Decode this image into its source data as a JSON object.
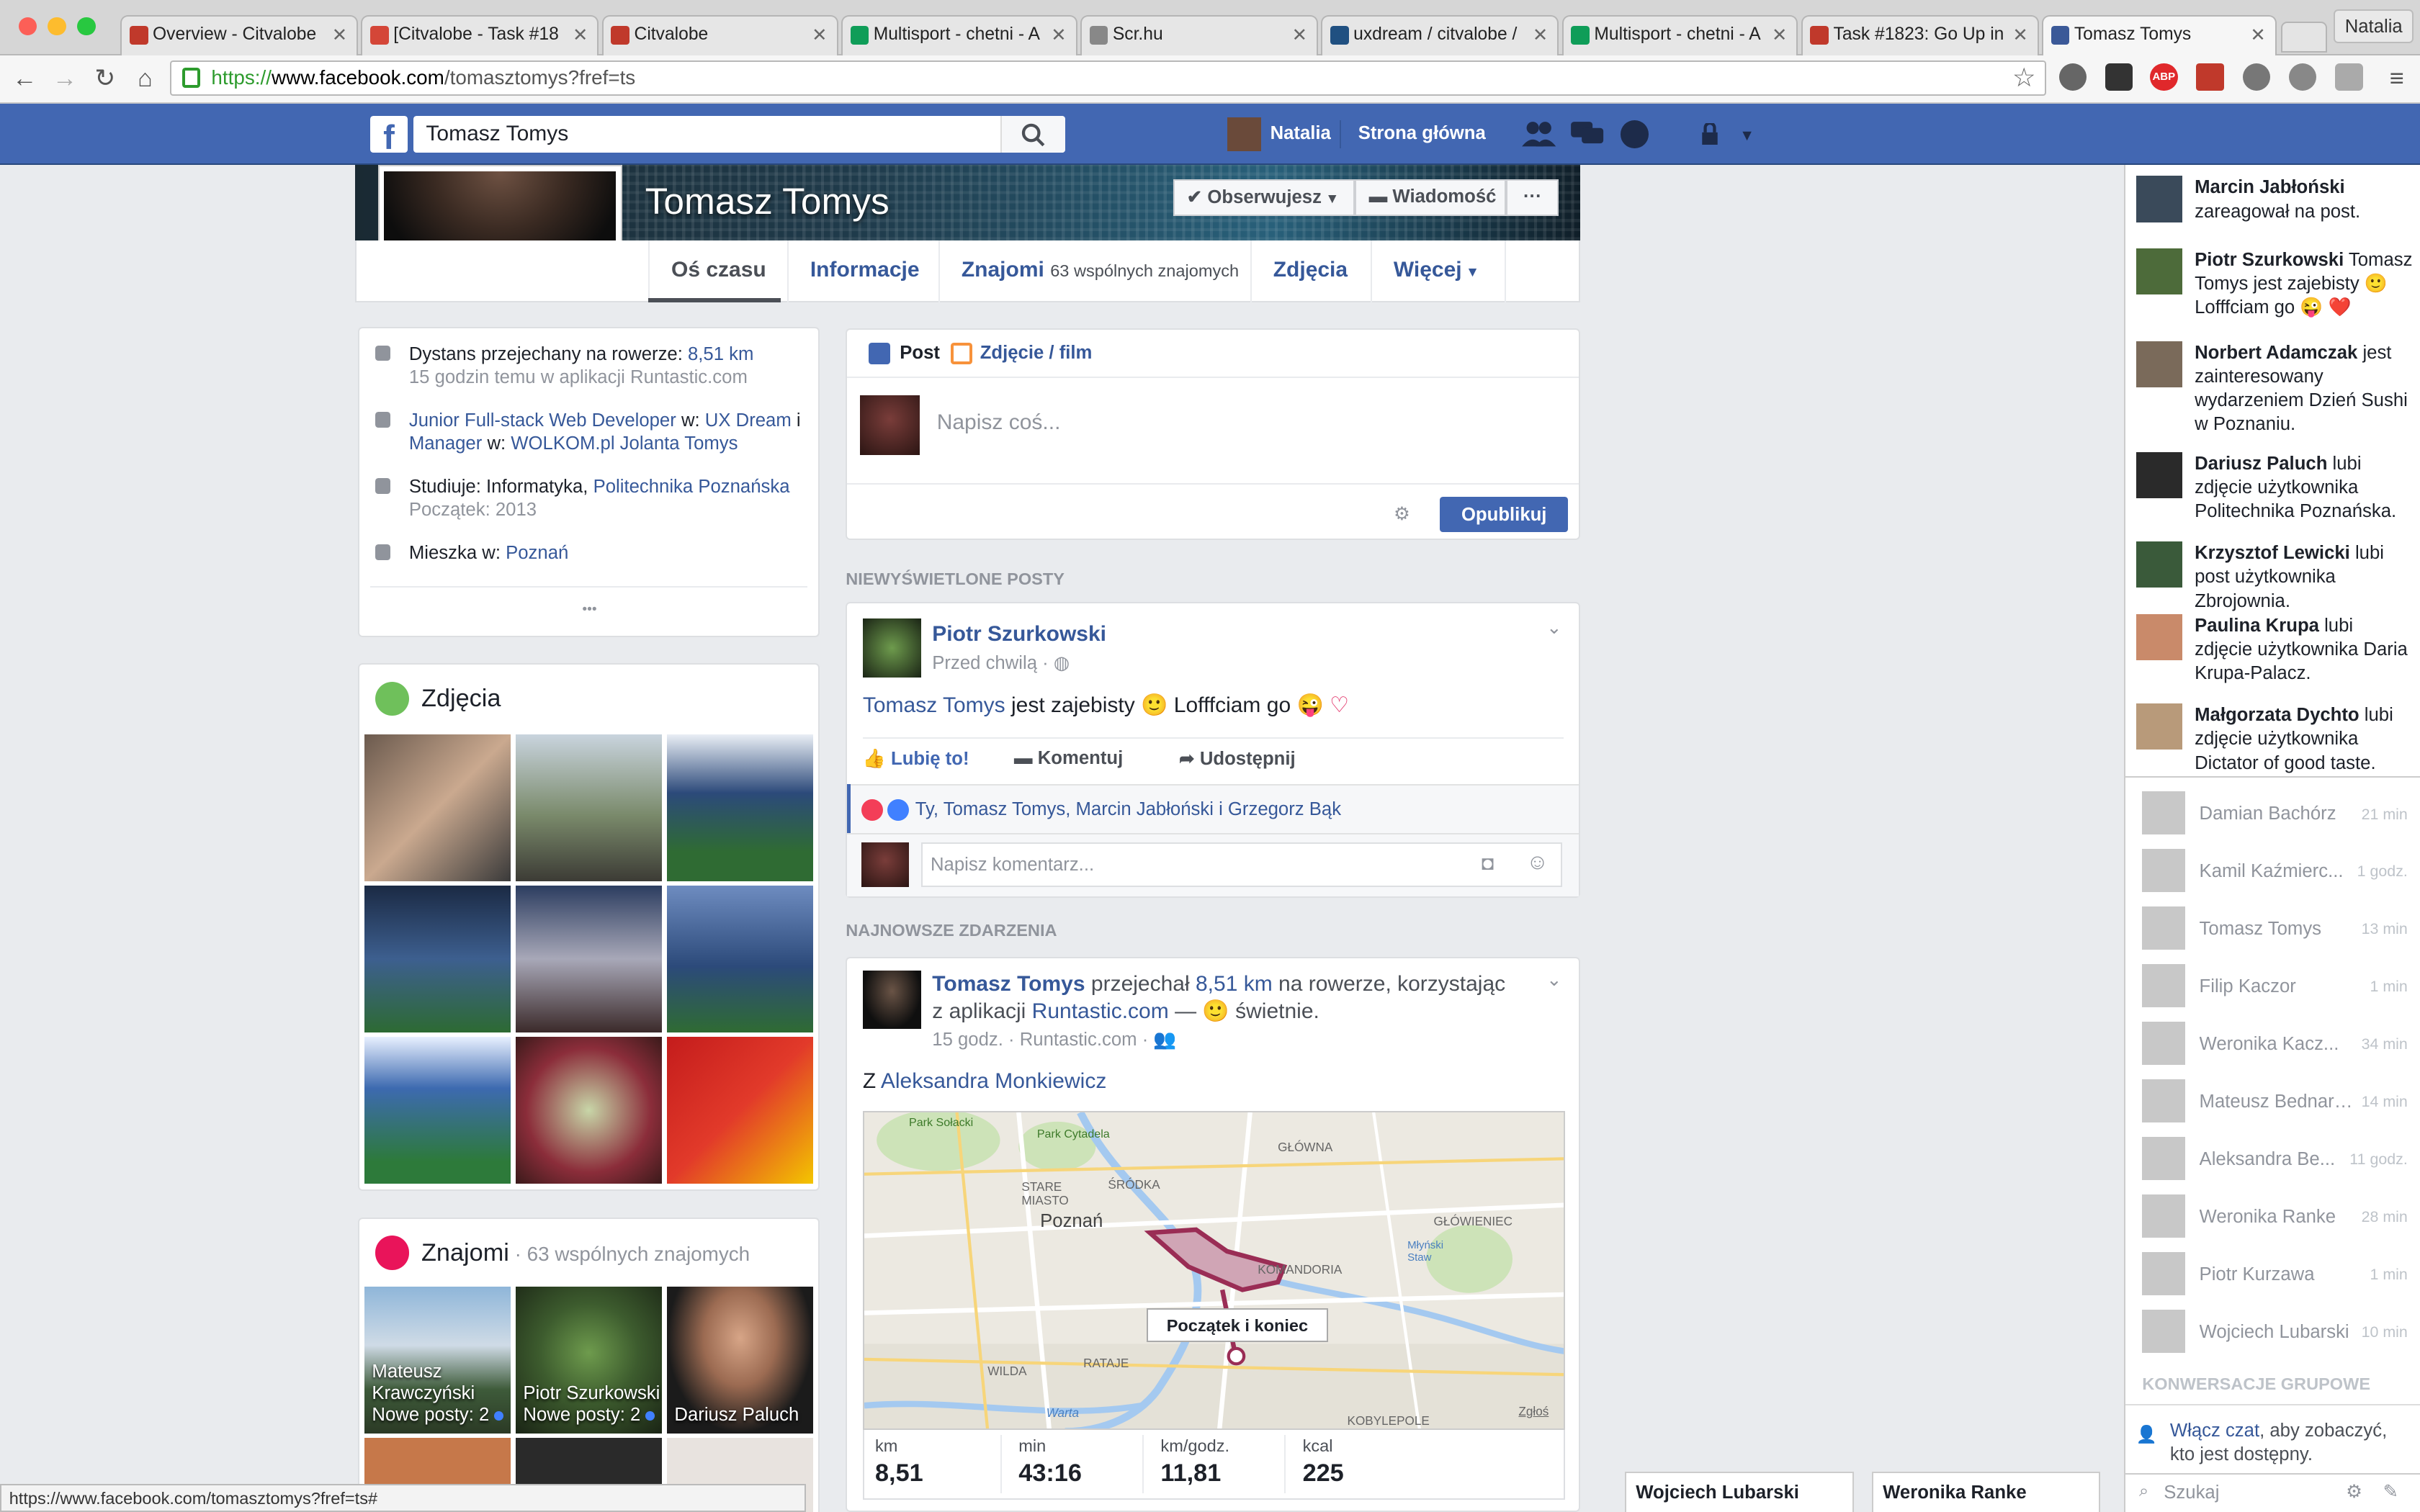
{
  "browser": {
    "tabs": [
      {
        "title": "Overview - Citvalobe",
        "fav": "#c0392b"
      },
      {
        "title": "[Citvalobe - Task #18",
        "fav": "#d44638"
      },
      {
        "title": "Citvalobe",
        "fav": "#c0392b"
      },
      {
        "title": "Multisport - chetni - A",
        "fav": "#0f9d58"
      },
      {
        "title": "Scr.hu",
        "fav": "#888888"
      },
      {
        "title": "uxdream / citvalobe /",
        "fav": "#205081"
      },
      {
        "title": "Multisport - chetni - A",
        "fav": "#0f9d58"
      },
      {
        "title": "Task #1823: Go Up in",
        "fav": "#c0392b"
      },
      {
        "title": "Tomasz Tomys",
        "fav": "#3b5998"
      }
    ],
    "profile_label": "Natalia",
    "url_https": "https://",
    "url_host": "www.facebook.com",
    "url_path": "/tomasztomys?fref=ts",
    "status_url": "https://www.facebook.com/tomasztomys?fref=ts#"
  },
  "fb_header": {
    "search_value": "Tomasz Tomys",
    "user_name": "Natalia",
    "home_label": "Strona główna"
  },
  "profile": {
    "name": "Tomasz Tomys",
    "follow_label": "Obserwujesz",
    "message_label": "Wiadomość",
    "more_label": "···",
    "tabs": {
      "timeline": "Oś czasu",
      "about": "Informacje",
      "friends": "Znajomi",
      "friends_sub": "63 wspólnych znajomych",
      "photos": "Zdjęcia",
      "more": "Więcej"
    }
  },
  "intro": {
    "bike_prefix": "Dystans przejechany na rowerze: ",
    "bike_value": "8,51 km",
    "bike_sub": "15 godzin temu w aplikacji Runtastic.com",
    "job_title": "Junior Full-stack Web Developer",
    "job_w1": " w: ",
    "job_company": "UX Dream",
    "job_and": " i",
    "job_title2": "Manager",
    "job_w2": " w: ",
    "job_company2": "WOLKOM.pl Jolanta Tomys",
    "study_prefix": "Studiuje: Informatyka, ",
    "study_school": "Politechnika Poznańska",
    "study_sub": "Początek: 2013",
    "lives_prefix": "Mieszka w: ",
    "lives_city": "Poznań",
    "more": "•••"
  },
  "photos_card": {
    "title": "Zdjęcia"
  },
  "friends_card": {
    "title": "Znajomi",
    "sub": " · 63 wspólnych znajomych",
    "friends": [
      {
        "name": "Mateusz Krawczyński",
        "sub": "Nowe posty: 2"
      },
      {
        "name": "Piotr Szurkowski",
        "sub": "Nowe posty: 2"
      },
      {
        "name": "Dariusz Paluch",
        "sub": ""
      }
    ]
  },
  "composer": {
    "tab_post": "Post",
    "tab_photo": "Zdjęcie / film",
    "placeholder": "Napisz coś...",
    "publish": "Opublikuj"
  },
  "sections": {
    "unseen": "NIEWYŚWIETLONE POSTY",
    "recent": "NAJNOWSZE ZDARZENIA"
  },
  "post1": {
    "author": "Piotr Szurkowski",
    "time": "Przed chwilą · ",
    "text_link": "Tomasz Tomys",
    "text_mid": " jest zajebisty ",
    "text_end": " Lofffciam go ",
    "like": "Lubię to!",
    "comment": "Komentuj",
    "share": "Udostępnij",
    "reactions": "Ty, Tomasz Tomys, Marcin Jabłoński i Grzegorz Bąk",
    "comment_placeholder": "Napisz komentarz..."
  },
  "post2": {
    "author": "Tomasz Tomys",
    "verb": " przejechał ",
    "distance": "8,51 km",
    "mid": " na rowerze, korzystając z aplikacji ",
    "app": "Runtastic.com",
    "feeling": " — ",
    "feeling2": " świetnie.",
    "time": "15 godz. · Runtastic.com · ",
    "with_prefix": "Z ",
    "with_name": "Aleksandra Monkiewicz",
    "map_marker": "Początek i koniec",
    "map_labels": {
      "park1": "Park Sołacki",
      "park2": "Park Cytadela",
      "glowna": "GŁÓWNA",
      "stare": "STARE MIASTO",
      "srodka": "ŚRÓDKA",
      "poznan": "Poznań",
      "glowieniec": "GŁÓWIENIEC",
      "komandoria": "KOMANDORIA",
      "mlynski": "Młyński Staw",
      "rataje": "RATAJE",
      "wilda": "WILDA",
      "warta": "Warta",
      "kobylepole": "KOBYLEPOLE",
      "zglos": "Zgłoś"
    },
    "stats": [
      {
        "label": "km",
        "value": "8,51"
      },
      {
        "label": "min",
        "value": "43:16"
      },
      {
        "label": "km/godz.",
        "value": "11,81"
      },
      {
        "label": "kcal",
        "value": "225"
      }
    ]
  },
  "ticker": [
    {
      "name": "Marcin Jabłoński",
      "text": " zareagował na post."
    },
    {
      "name": "Piotr Szurkowski",
      "text": " Tomasz Tomys jest zajebisty 🙂 Lofffciam go 😜 ❤️"
    },
    {
      "name": "Norbert Adamczak",
      "text": " jest zainteresowany wydarzeniem Dzień Sushi w Poznaniu."
    },
    {
      "name": "Dariusz Paluch",
      "text": " lubi zdjęcie użytkownika Politechnika Poznańska."
    },
    {
      "name": "Krzysztof Lewicki",
      "text": " lubi post użytkownika Zbrojownia."
    },
    {
      "name": "Paulina Krupa",
      "text": " lubi zdjęcie użytkownika Daria Krupa-Palacz."
    },
    {
      "name": "Małgorzata Dychto",
      "text": " lubi zdjęcie użytkownika Dictator of good taste."
    }
  ],
  "chat": [
    {
      "name": "Damian Bachórz",
      "time": "21 min"
    },
    {
      "name": "Kamil Kaźmierc...",
      "time": "1 godz."
    },
    {
      "name": "Tomasz Tomys",
      "time": "13 min"
    },
    {
      "name": "Filip Kaczor",
      "time": "1 min"
    },
    {
      "name": "Weronika Kacz...",
      "time": "34 min"
    },
    {
      "name": "Mateusz Bednarski",
      "time": "14 min"
    },
    {
      "name": "Aleksandra Be...",
      "time": "11 godz."
    },
    {
      "name": "Weronika Ranke",
      "time": "28 min"
    },
    {
      "name": "Piotr Kurzawa",
      "time": "1 min"
    },
    {
      "name": "Wojciech Lubarski",
      "time": "10 min"
    }
  ],
  "chat_section": "KONWERSACJE GRUPOWE",
  "chat_enable_link": "Włącz czat",
  "chat_enable_rest": ", aby zobaczyć, kto jest dostępny.",
  "chat_search_placeholder": "Szukaj",
  "chat_tabs": [
    "Wojciech Lubarski",
    "Weronika Ranke"
  ],
  "colors": {
    "fb_blue": "#4267b2",
    "link": "#365899",
    "like": "#4080ff"
  }
}
